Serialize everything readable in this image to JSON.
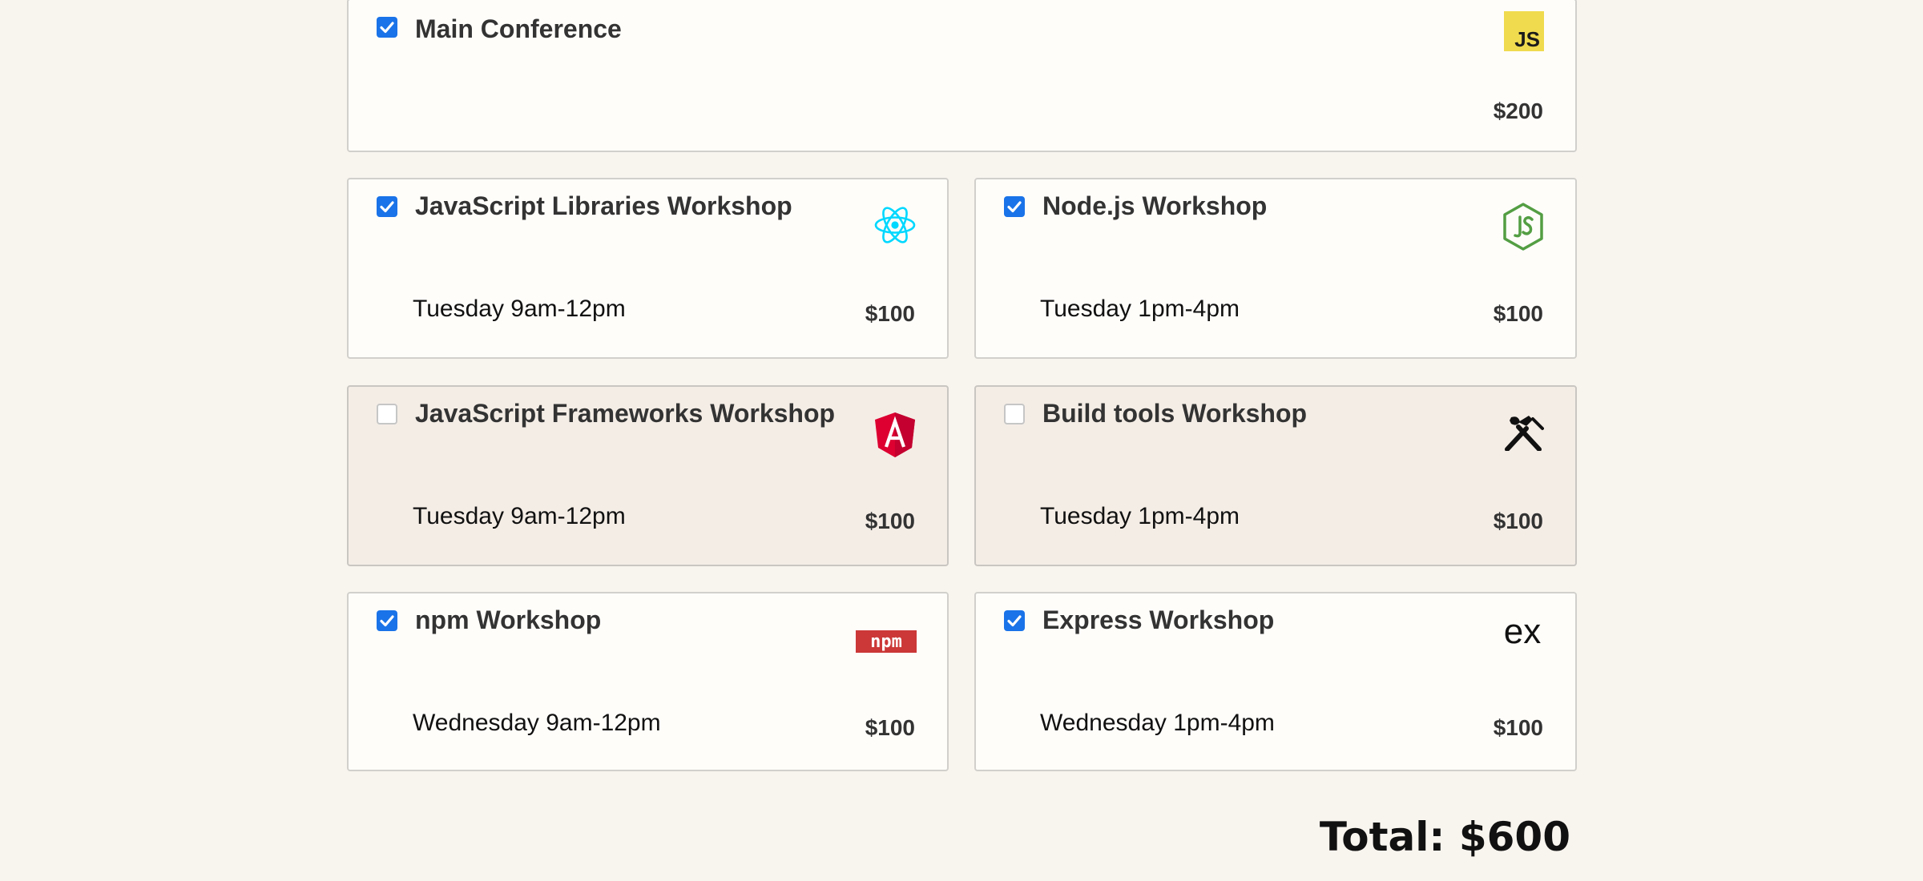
{
  "checkbox_states": {
    "main": true,
    "libs": true,
    "node": true,
    "frameworks": false,
    "buildtools": false,
    "npm": true,
    "express": true
  },
  "main": {
    "title": "Main Conference",
    "price": "$200",
    "logo": "js-icon"
  },
  "workshops": [
    {
      "key": "libs",
      "title": "JavaScript Libraries Workshop",
      "time": "Tuesday 9am-12pm",
      "price": "$100",
      "logo": "react-icon"
    },
    {
      "key": "node",
      "title": "Node.js Workshop",
      "time": "Tuesday 1pm-4pm",
      "price": "$100",
      "logo": "nodejs-icon"
    },
    {
      "key": "frameworks",
      "title": "JavaScript Frameworks Workshop",
      "time": "Tuesday 9am-12pm",
      "price": "$100",
      "logo": "angular-icon"
    },
    {
      "key": "buildtools",
      "title": "Build tools Workshop",
      "time": "Tuesday 1pm-4pm",
      "price": "$100",
      "logo": "tools-icon"
    },
    {
      "key": "npm",
      "title": "npm Workshop",
      "time": "Wednesday 9am-12pm",
      "price": "$100",
      "logo": "npm-icon"
    },
    {
      "key": "express",
      "title": "Express Workshop",
      "time": "Wednesday 1pm-4pm",
      "price": "$100",
      "logo": "express-icon"
    }
  ],
  "logo_texts": {
    "js": "JS",
    "npm": "npm",
    "express": "ex"
  },
  "total_label": "Total: $600",
  "colors": {
    "accent": "#1a73e8",
    "js_yellow": "#f0db4f",
    "react": "#00d8ff",
    "node": "#539e43",
    "angular": "#dd0031",
    "npm": "#cb3837"
  }
}
